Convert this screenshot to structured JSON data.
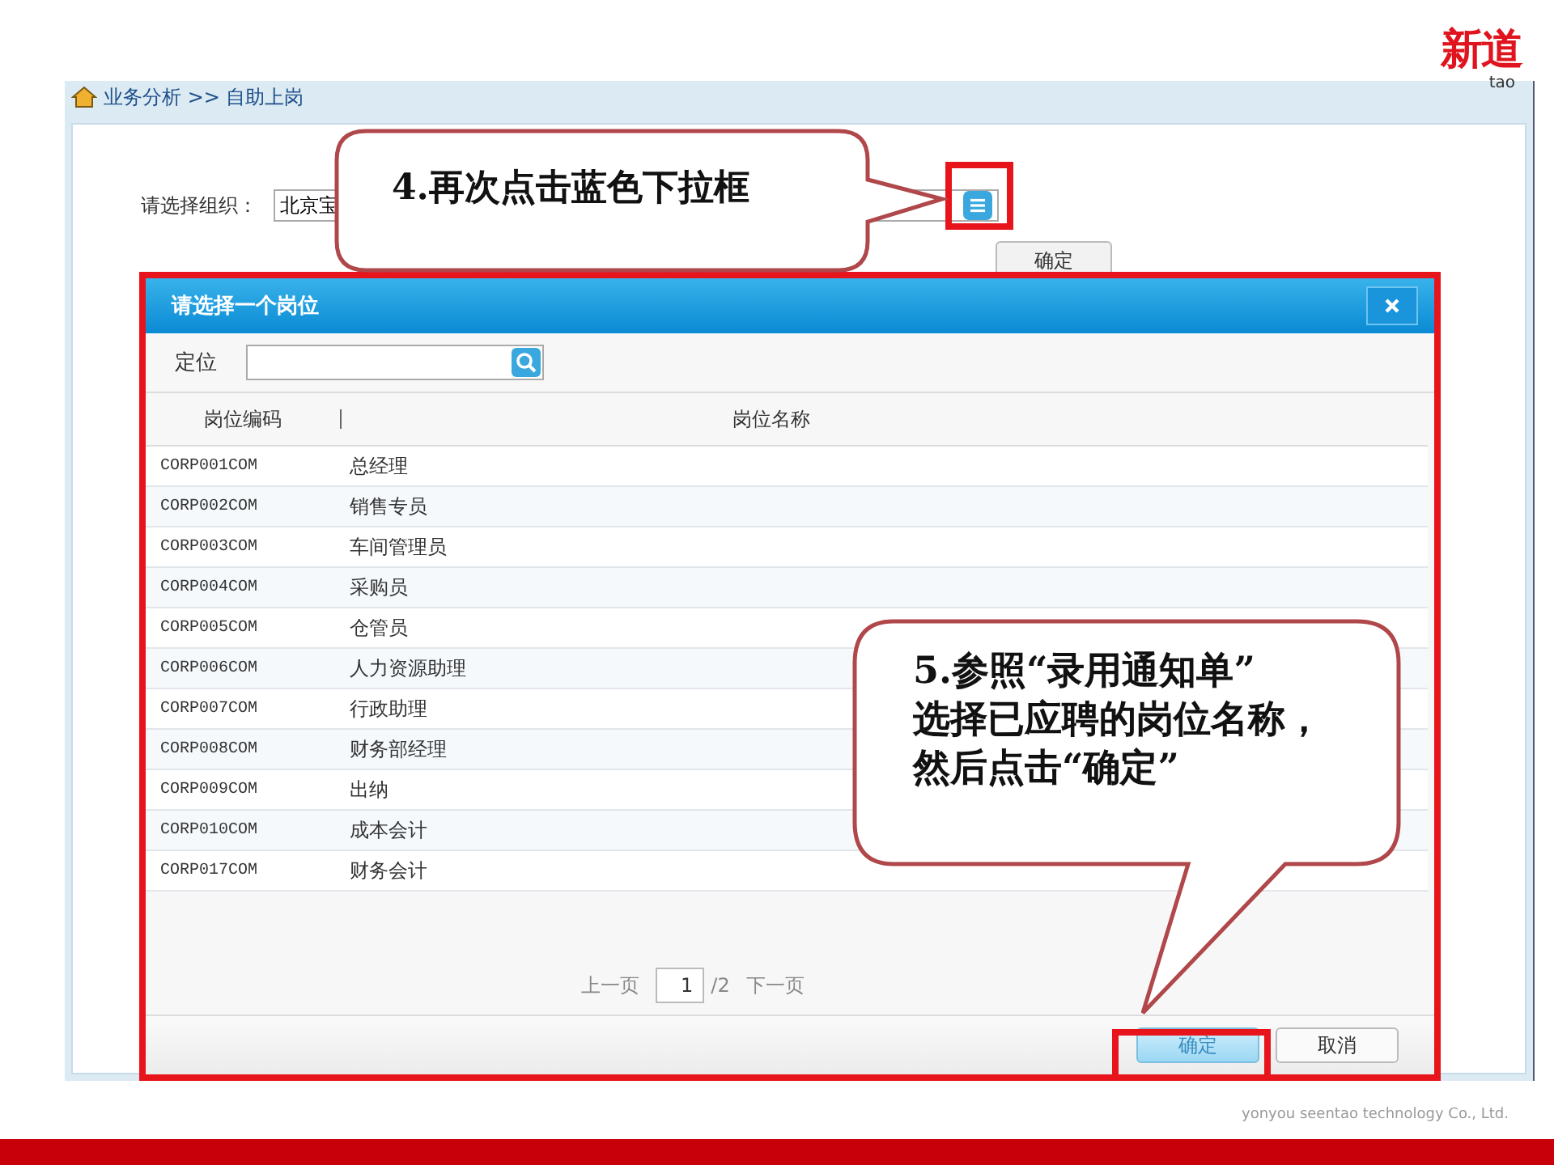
{
  "logo": {
    "text": "新道",
    "subtext": "tao"
  },
  "breadcrumb": "业务分析 >> 自助上岗",
  "org_field": {
    "label": "请选择组织：",
    "value": "北京宝"
  },
  "confirm_button": "确定",
  "dialog": {
    "title": "请选择一个岗位",
    "search_label": "定位",
    "columns": [
      "岗位编码",
      "岗位名称"
    ],
    "rows": [
      {
        "code": "CORP001COM",
        "name": "总经理"
      },
      {
        "code": "CORP002COM",
        "name": "销售专员"
      },
      {
        "code": "CORP003COM",
        "name": "车间管理员"
      },
      {
        "code": "CORP004COM",
        "name": "采购员"
      },
      {
        "code": "CORP005COM",
        "name": "仓管员"
      },
      {
        "code": "CORP006COM",
        "name": "人力资源助理"
      },
      {
        "code": "CORP007COM",
        "name": "行政助理"
      },
      {
        "code": "CORP008COM",
        "name": "财务部经理"
      },
      {
        "code": "CORP009COM",
        "name": "出纳"
      },
      {
        "code": "CORP010COM",
        "name": "成本会计"
      },
      {
        "code": "CORP017COM",
        "name": "财务会计"
      }
    ],
    "pager": {
      "prev": "上一页",
      "page": "1",
      "total": "/2",
      "next": "下一页"
    },
    "buttons": [
      {
        "label": "确定",
        "primary": true
      },
      {
        "label": "取消",
        "primary": false
      }
    ]
  },
  "callouts": [
    {
      "lines": [
        "4.再次点击蓝色下拉框"
      ]
    },
    {
      "lines": [
        "5.参照“录用通知单”",
        "选择已应聘的岗位名称，",
        "然后点击“确定”"
      ]
    }
  ],
  "footer": "yonyou seentao technology Co., Ltd."
}
